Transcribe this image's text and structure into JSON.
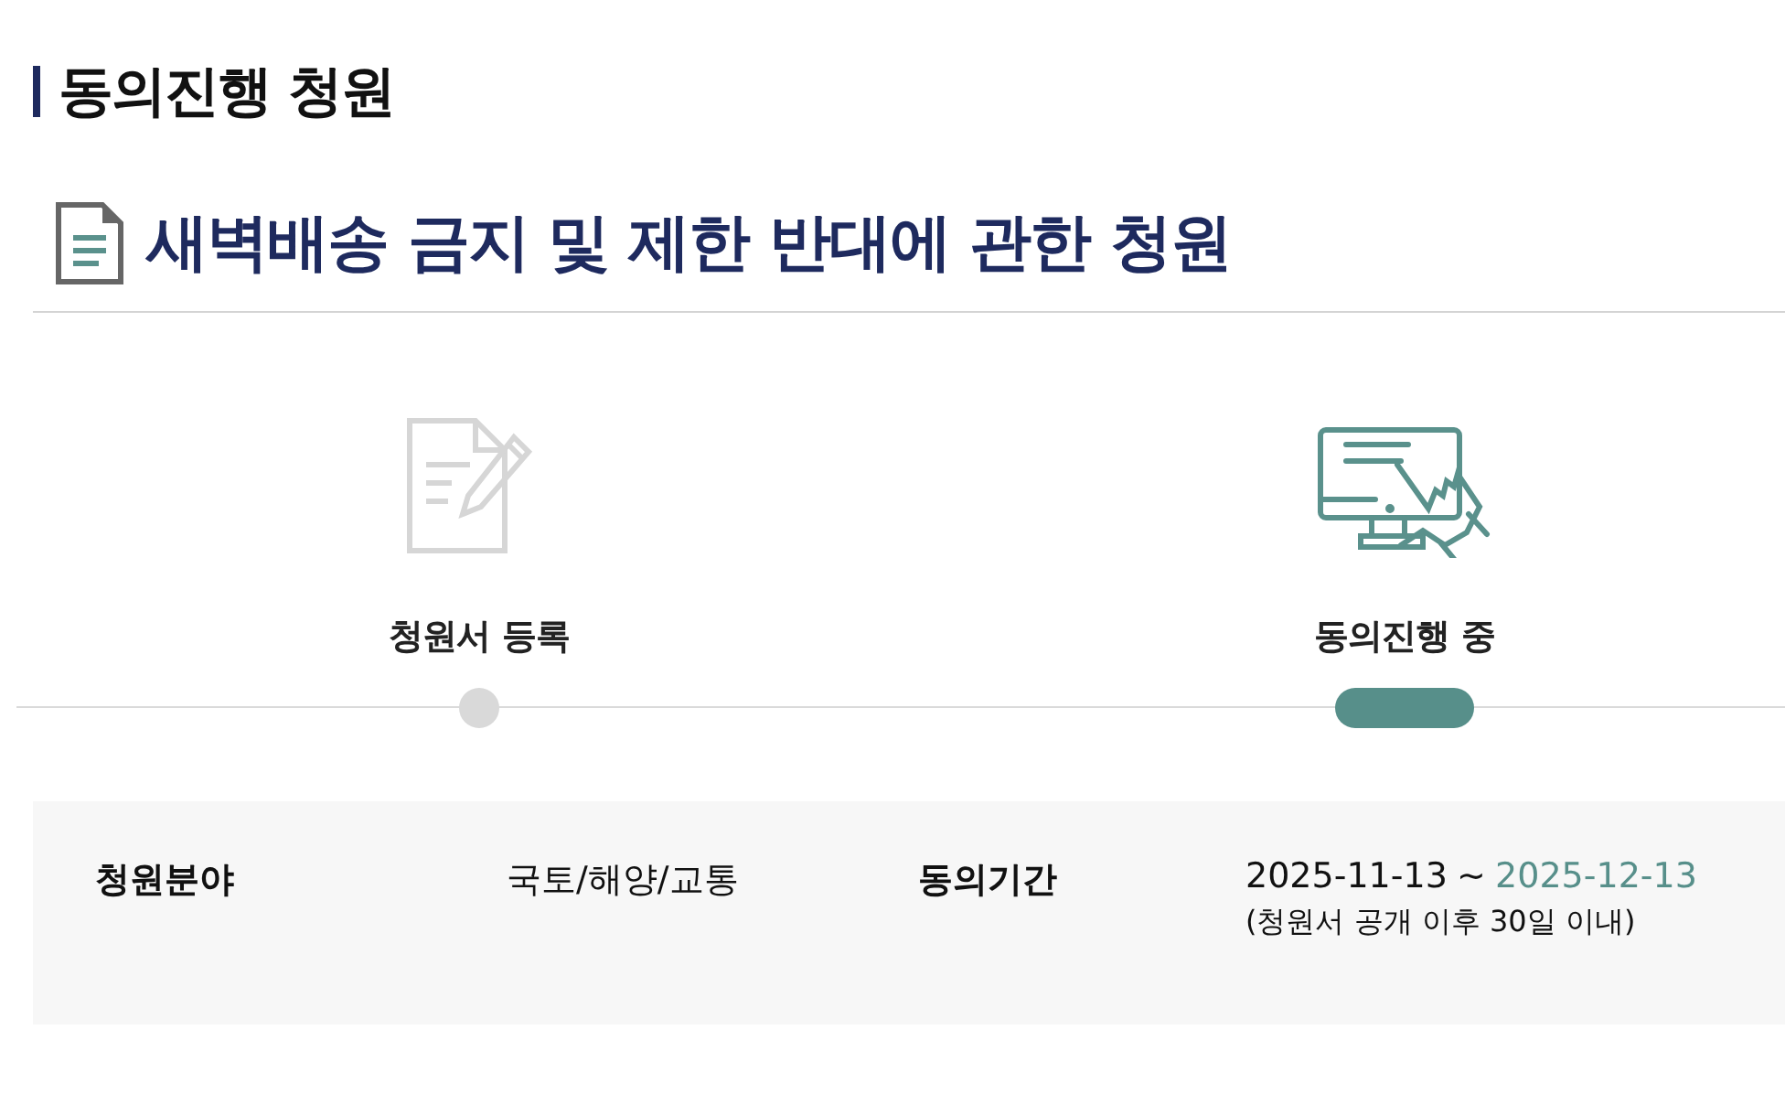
{
  "section_title": "동의진행 청원",
  "petition_title": "새벽배송 금지 및 제한 반대에 관한 청원",
  "steps": [
    {
      "label": "청원서 등록",
      "selected": false
    },
    {
      "label": "동의진행 중",
      "selected": true
    }
  ],
  "info": [
    {
      "kind": "text",
      "label": "청원분야",
      "value": "국토/해양/교통"
    },
    {
      "kind": "period",
      "label": "동의기간",
      "start": "2025-11-13",
      "separator": "~",
      "end": "2025-12-13",
      "note": "(청원서 공개 이후 30일 이내)"
    }
  ]
}
